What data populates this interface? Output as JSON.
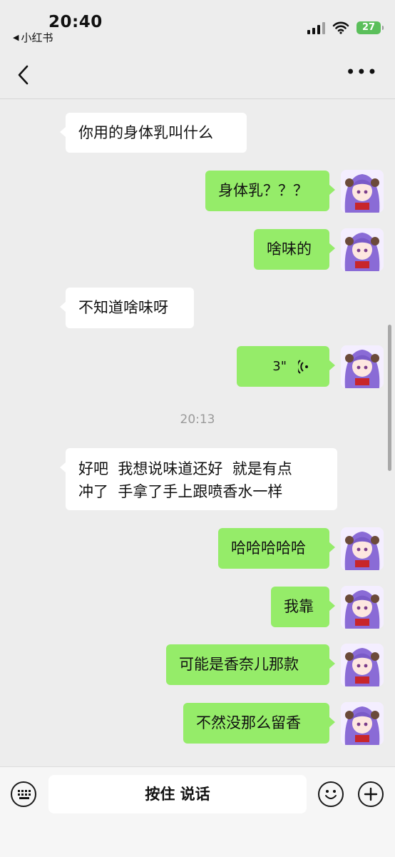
{
  "status_bar": {
    "time": "20:40",
    "back_app_label": "小红书",
    "battery_level": "27"
  },
  "navbar": {
    "back_icon": "chevron-left-icon",
    "more_icon": "more-dots-icon"
  },
  "messages": [
    {
      "side": "left",
      "text": "你用的身体乳叫什么"
    },
    {
      "side": "right",
      "text": "身体乳？？？"
    },
    {
      "side": "right",
      "text": "啥味的"
    },
    {
      "side": "left",
      "text": "不知道啥味呀"
    },
    {
      "side": "right",
      "type": "voice",
      "duration": "3\""
    },
    {
      "timestamp": "20:13"
    },
    {
      "side": "left",
      "text_lines": [
        "好吧  我想说味道还好  就是有点",
        "冲了  手拿了手上跟喷香水一样"
      ]
    },
    {
      "side": "right",
      "text": "哈哈哈哈哈"
    },
    {
      "side": "right",
      "text": "我靠"
    },
    {
      "side": "right",
      "text": "可能是香奈儿那款"
    },
    {
      "side": "right",
      "text": "不然没那么留香"
    }
  ],
  "input_bar": {
    "hold_to_talk_label": "按住 说话",
    "keyboard_icon": "keyboard-icon",
    "emoji_icon": "emoji-icon",
    "add_icon": "plus-icon"
  },
  "colors": {
    "background": "#ededed",
    "sent_bubble": "#95ec69",
    "received_bubble": "#ffffff",
    "battery": "#5bbf5b"
  }
}
